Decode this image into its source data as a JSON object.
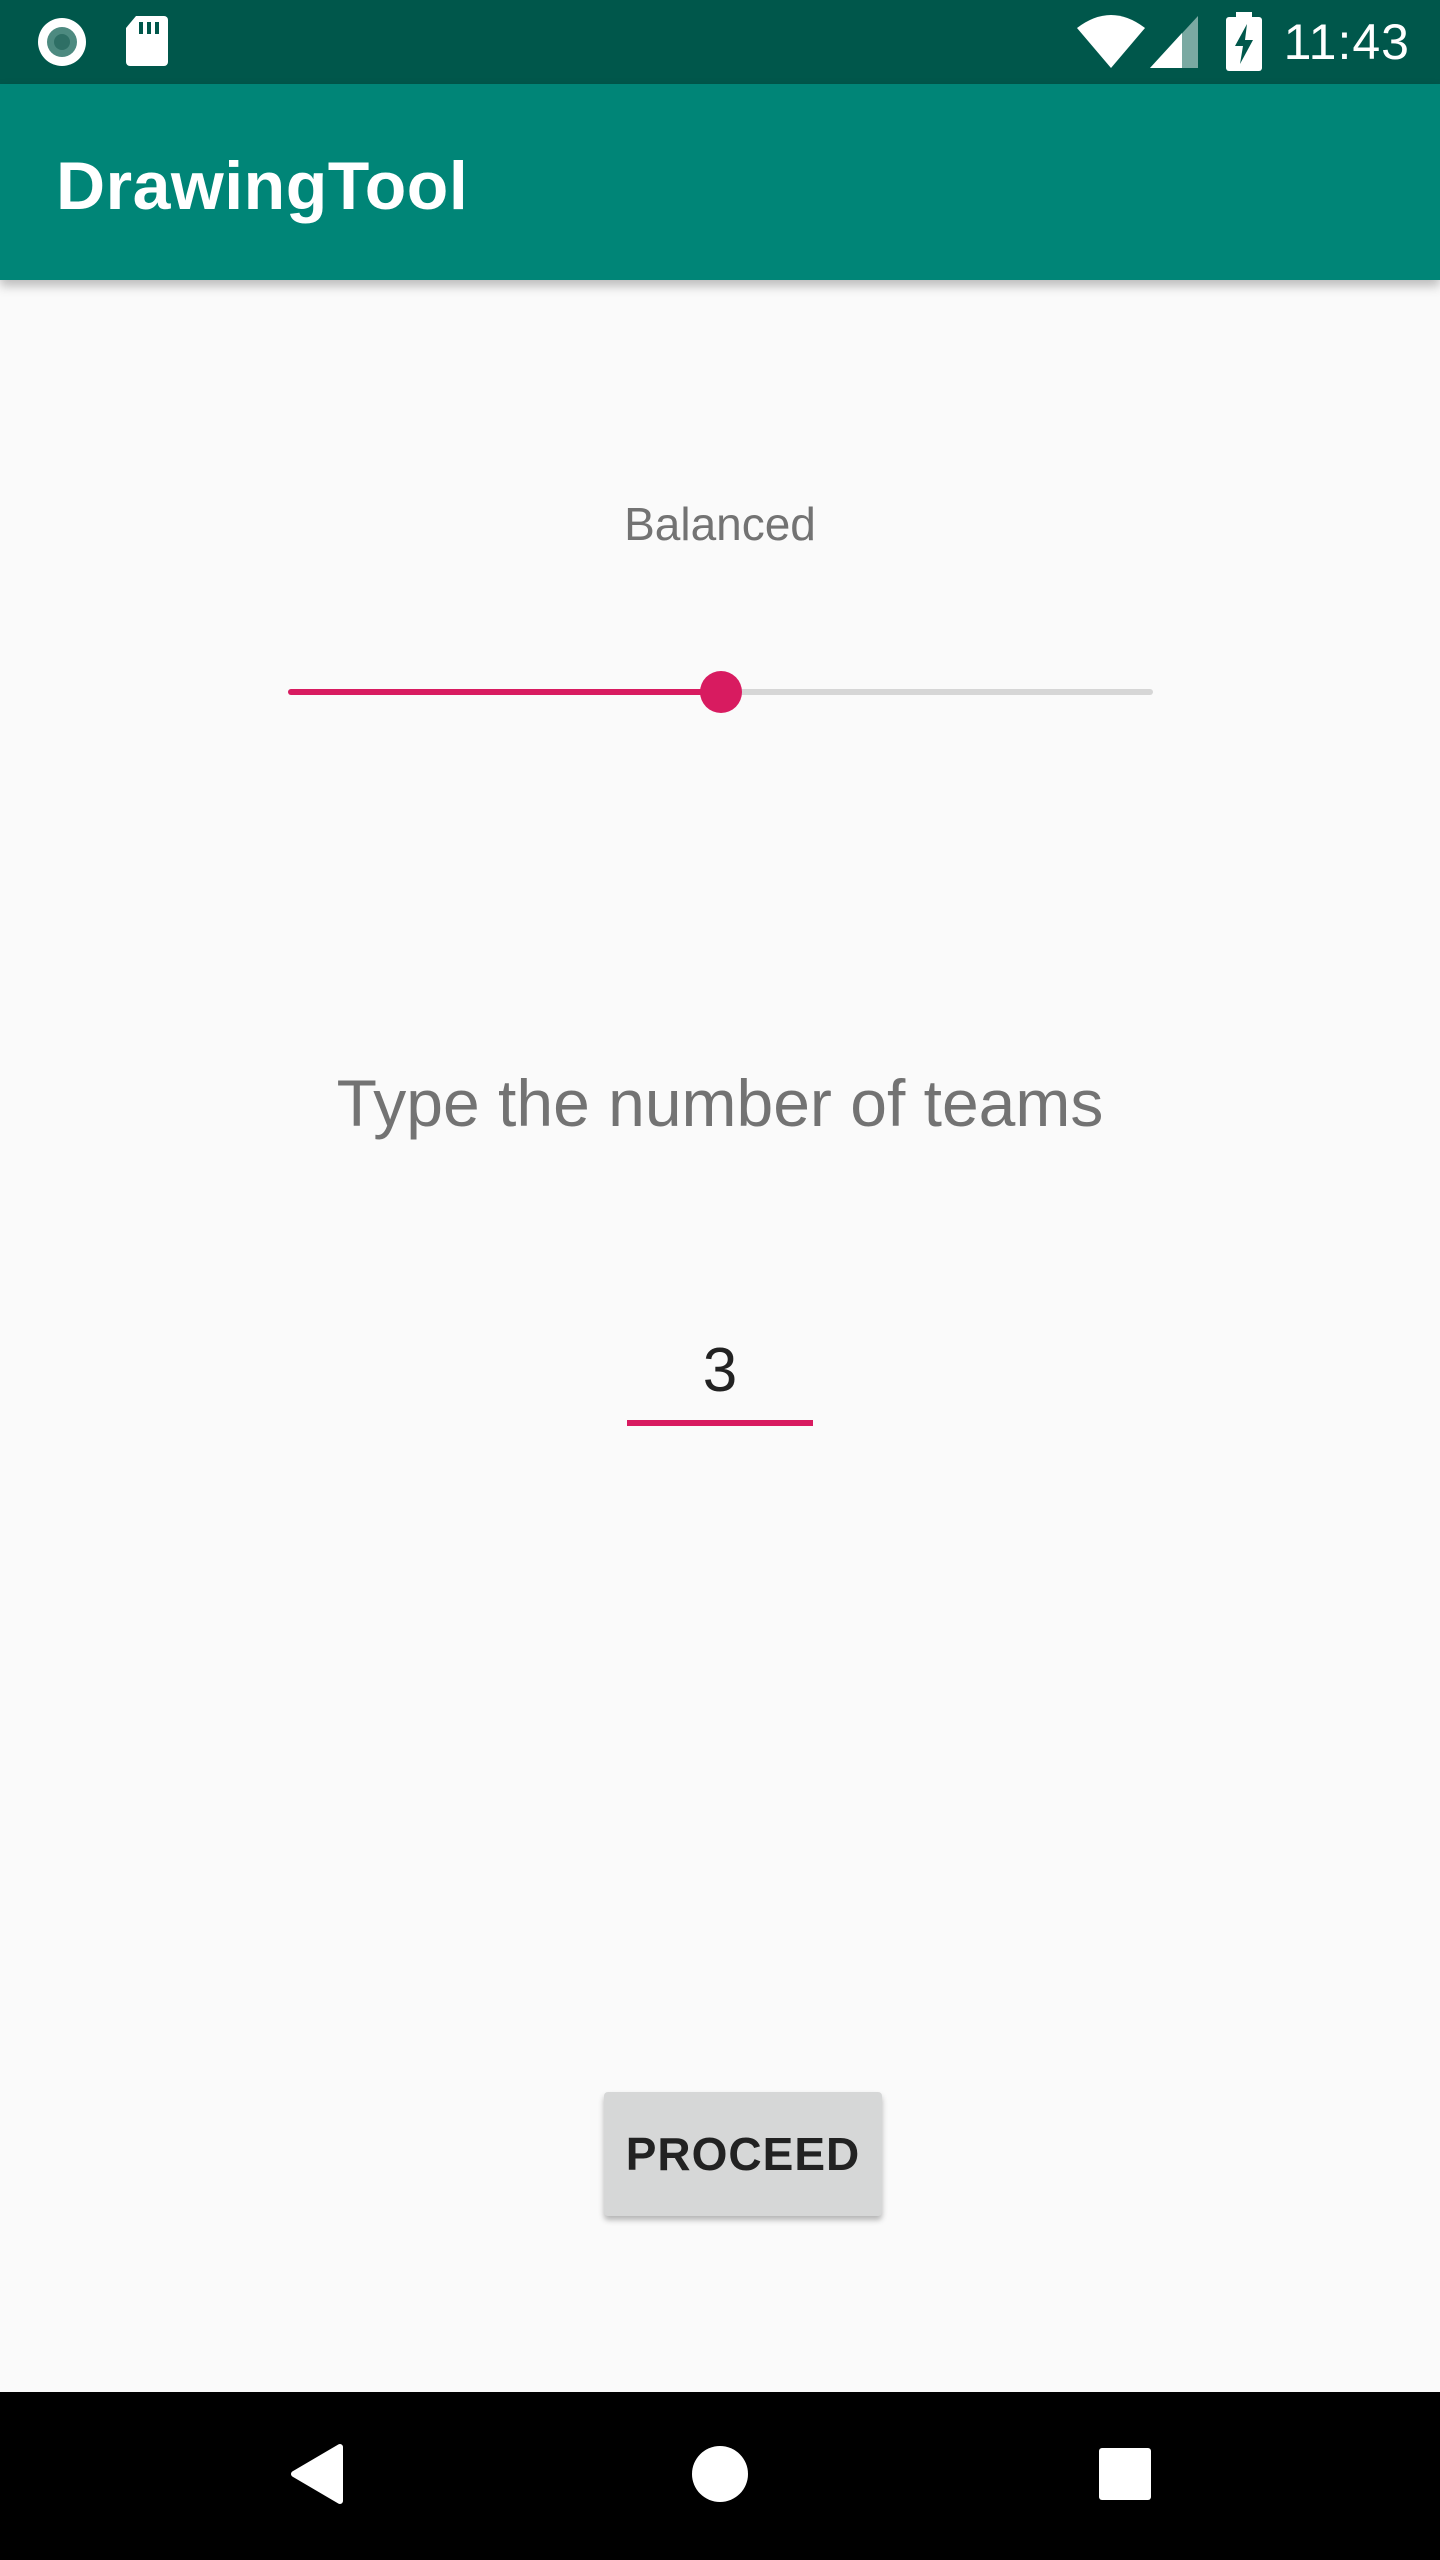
{
  "status_bar": {
    "time": "11:43",
    "icons": [
      "notification-circle-icon",
      "sd-card-icon",
      "wifi-icon",
      "cell-signal-icon",
      "battery-charging-icon"
    ]
  },
  "app_bar": {
    "title": "DrawingTool"
  },
  "mode_slider": {
    "label": "Balanced",
    "value_fraction": 0.5,
    "accent_color": "#d81b60"
  },
  "teams": {
    "prompt": "Type the number of teams",
    "value": "3"
  },
  "proceed_button": {
    "label": "PROCEED"
  },
  "nav_bar": {
    "icons": [
      "back-icon",
      "home-icon",
      "recents-icon"
    ]
  },
  "colors": {
    "status_bar": "#00574b",
    "app_bar": "#008577",
    "accent": "#d81b60",
    "background": "#fafafa"
  }
}
